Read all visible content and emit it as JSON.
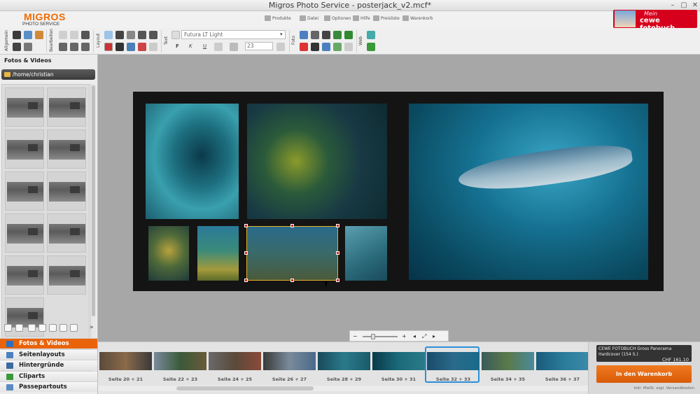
{
  "window": {
    "title": "Migros Photo Service - posterjack_v2.mcf*",
    "minimize": "–",
    "restore": "▢",
    "close": "✕"
  },
  "brand": {
    "name": "MIGROS",
    "sub": "PHOTO SERVICE",
    "accent": "#f06a00"
  },
  "menu": [
    {
      "label": "Produkte",
      "icon": "products-icon"
    },
    {
      "label": "Datei",
      "icon": "file-icon"
    },
    {
      "label": "Optionen",
      "icon": "options-icon"
    },
    {
      "label": "Hilfe",
      "icon": "help-icon"
    },
    {
      "label": "Preisliste",
      "icon": "pricelist-icon"
    },
    {
      "label": "Warenkorb",
      "icon": "cart-icon"
    }
  ],
  "cewe": {
    "mein": "Mein",
    "brand": "cewe fotobuch"
  },
  "toolbar": {
    "groups": [
      "Allgemein",
      "Bearbeiten",
      "Layout",
      "Text",
      "Foto",
      "Web"
    ],
    "font": "Futura LT Light",
    "font_size": "23",
    "bold": "F",
    "italic": "K",
    "underline": "U"
  },
  "left_panel": {
    "title": "Fotos & Videos",
    "path": "/home/christian",
    "nav": [
      {
        "label": "Fotos & Videos",
        "icon": "photos-icon",
        "active": true
      },
      {
        "label": "Seitenlayouts",
        "icon": "layouts-icon",
        "active": false
      },
      {
        "label": "Hintergründe",
        "icon": "backgrounds-icon",
        "active": false
      },
      {
        "label": "Cliparts",
        "icon": "cliparts-icon",
        "active": false
      },
      {
        "label": "Passepartouts",
        "icon": "passepartouts-icon",
        "active": false
      }
    ],
    "expand": "»"
  },
  "zoom": {
    "out": "−",
    "in": "+",
    "prev": "◂",
    "next": "▸",
    "fit": "⤢"
  },
  "filmstrip": [
    {
      "label": "Seite 20 + 21",
      "selected": false
    },
    {
      "label": "Seite 22 + 23",
      "selected": false
    },
    {
      "label": "Seite 24 + 25",
      "selected": false
    },
    {
      "label": "Seite 26 + 27",
      "selected": false
    },
    {
      "label": "Seite 28 + 29",
      "selected": false
    },
    {
      "label": "Seite 30 + 31",
      "selected": false
    },
    {
      "label": "Seite 32 + 33",
      "selected": true
    },
    {
      "label": "Seite 34 + 35",
      "selected": false
    },
    {
      "label": "Seite 36 + 37",
      "selected": false
    }
  ],
  "product": {
    "name": "CEWE FOTOBUCH Gross Panorama",
    "spec": "Hardcover  (154 S.)",
    "price": "CHF 161.10",
    "cart_button": "In den Warenkorb",
    "vat_note": "Inkl. MwSt. zzgl. Versandkosten"
  }
}
